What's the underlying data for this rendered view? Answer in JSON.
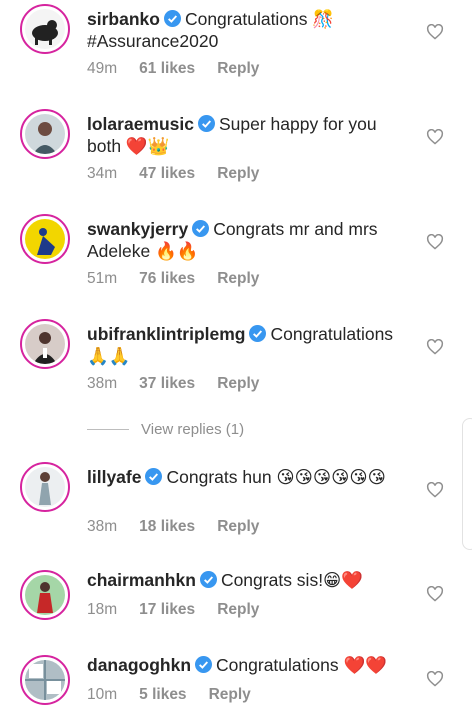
{
  "comments": [
    {
      "username": "sirbanko",
      "text": "Congratulations 🎊 #Assurance2020",
      "time": "49m",
      "likes": "61 likes",
      "reply": "Reply"
    },
    {
      "username": "lolaraemusic",
      "text": "Super happy for you both ❤️👑",
      "time": "34m",
      "likes": "47 likes",
      "reply": "Reply"
    },
    {
      "username": "swankyjerry",
      "text": "Congrats mr and mrs Adeleke 🔥🔥",
      "time": "51m",
      "likes": "76 likes",
      "reply": "Reply"
    },
    {
      "username": "ubifranklintriplemg",
      "text": "Congratulations 🙏🙏",
      "time": "38m",
      "likes": "37 likes",
      "reply": "Reply"
    },
    {
      "username": "lillyafe",
      "text": "Congrats hun 😘😘😘😘😘😘",
      "time": "38m",
      "likes": "18 likes",
      "reply": "Reply"
    },
    {
      "username": "chairmanhkn",
      "text": "Congrats sis!😁❤️",
      "time": "18m",
      "likes": "17 likes",
      "reply": "Reply"
    },
    {
      "username": "danagoghkn",
      "text": "Congratulations ❤️❤️",
      "time": "10m",
      "likes": "5 likes",
      "reply": "Reply"
    }
  ],
  "view_replies": "View replies (1)",
  "colors": {
    "verified": "#3897f0",
    "story_ring": "#d6249f",
    "meta_text": "#8e8e8e"
  }
}
